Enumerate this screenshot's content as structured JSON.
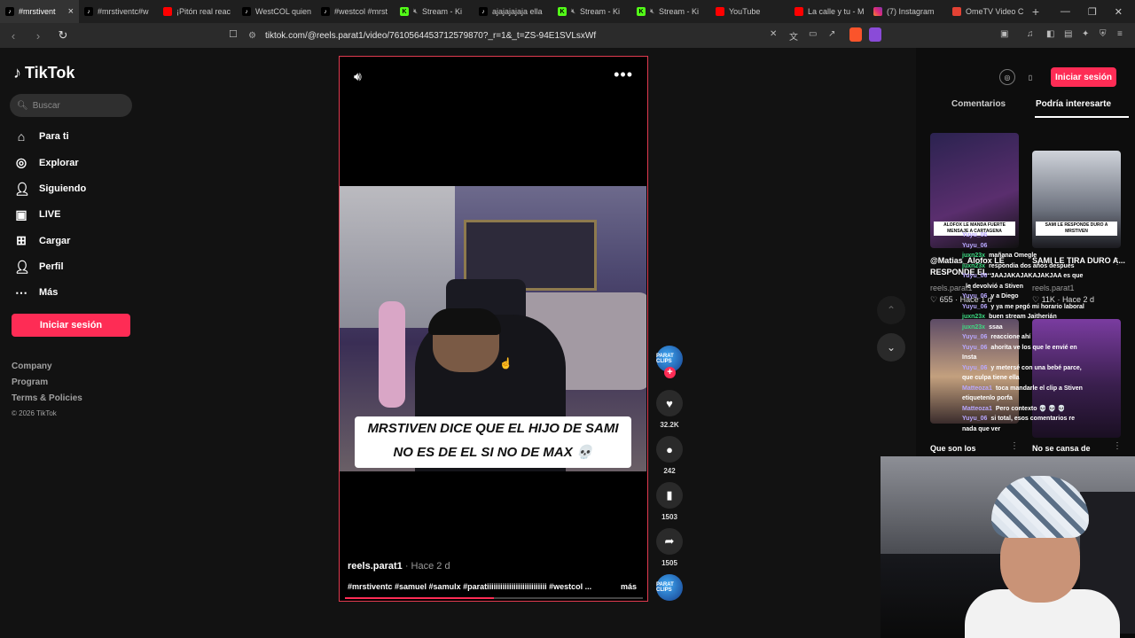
{
  "browser": {
    "tabs": [
      {
        "title": "#mrstivent",
        "fav": "tt",
        "active": true,
        "closable": true
      },
      {
        "title": "#mrstiventc#w",
        "fav": "tt"
      },
      {
        "title": "¡Pitón real reac",
        "fav": "yt"
      },
      {
        "title": "WestCOL quien",
        "fav": "tt"
      },
      {
        "title": "#westcol #mrst",
        "fav": "tt"
      },
      {
        "title": "Stream - Ki",
        "fav": "kick",
        "muted": true
      },
      {
        "title": "ajajajajaja ella",
        "fav": "tt"
      },
      {
        "title": "Stream - Ki",
        "fav": "kick",
        "muted": true
      },
      {
        "title": "Stream - Ki",
        "fav": "kick",
        "muted": true
      },
      {
        "title": "YouTube",
        "fav": "yt"
      },
      {
        "title": "La calle y tu - M",
        "fav": "yt"
      },
      {
        "title": "(7) Instagram",
        "fav": "ig"
      },
      {
        "title": "OmeTV Video C",
        "fav": "ome"
      }
    ],
    "url": "tiktok.com/@reels.parat1/video/7610564453712579870?_r=1&_t=ZS-94E1SVLsxWf"
  },
  "sidebar": {
    "logo": "TikTok",
    "search_placeholder": "Buscar",
    "nav": [
      {
        "label": "Para ti",
        "icon": "home-icon"
      },
      {
        "label": "Explorar",
        "icon": "compass-icon"
      },
      {
        "label": "Siguiendo",
        "icon": "following-icon"
      },
      {
        "label": "LIVE",
        "icon": "live-icon"
      },
      {
        "label": "Cargar",
        "icon": "upload-icon"
      },
      {
        "label": "Perfil",
        "icon": "profile-icon"
      },
      {
        "label": "Más",
        "icon": "more-icon"
      }
    ],
    "login": "Iniciar sesión",
    "footer": {
      "company": "Company",
      "program": "Program",
      "terms": "Terms & Policies",
      "copyright": "© 2026 TikTok"
    }
  },
  "video": {
    "caption_line1": "MRSTIVEN DICE QUE EL HIJO DE SAMI",
    "caption_line2": "NO ES DE EL SI NO DE MAX 💀",
    "author": "reels.parat1",
    "time": " · Hace 2 d",
    "tags": "#mrstiventc #samuel #samulx #paratiiiiiiiiiiiiiiiiiiiiiiiiiii #westcol ...",
    "more": "más",
    "progress": 0.5
  },
  "actions": {
    "likes": "32.2K",
    "comments": "242",
    "saves": "1503",
    "shares": "1505",
    "avatar_text": "PARAT CLIPS"
  },
  "right_panel": {
    "login": "Iniciar sesión",
    "tab_comments": "Comentarios",
    "tab_suggested": "Podría interesarte",
    "cards": [
      {
        "title": "@Matias_Alofox LE RESPONDE EL...",
        "author": "reels.parat1",
        "likes": "655",
        "time": "Hace 1 d",
        "thumb_caption": "ALOFOX LE MANDA FUERTE MENSAJE A CARTAGENA"
      },
      {
        "title": "SAMI LE TIRA DURO A...",
        "author": "reels.parat1",
        "likes": "11K",
        "time": "Hace 2 d",
        "thumb_caption": "SAMI LE RESPONDE DURO A MRSTIVEN"
      },
      {
        "title": "Que son los",
        "author": "",
        "likes": "",
        "time": ""
      },
      {
        "title": "No se cansa de",
        "author": "",
        "likes": "",
        "time": ""
      }
    ]
  },
  "chat": [
    {
      "user": "Yuyu_06",
      "color": "b",
      "msg": ""
    },
    {
      "user": "Yuyu_06",
      "color": "b",
      "msg": ""
    },
    {
      "user": "juxn23x",
      "color": "g",
      "msg": "mañana Omegle"
    },
    {
      "user": "juxn23x",
      "color": "g",
      "msg": "respondia dos años después"
    },
    {
      "user": "Yuyu_06",
      "color": "b",
      "msg": "JAAJAKAJAKAJAKJAA es que"
    },
    {
      "user": "",
      "color": "b",
      "msg": "le devolvió a Stiven"
    },
    {
      "user": "Yuyu_06",
      "color": "b",
      "msg": "y a Diego"
    },
    {
      "user": "Yuyu_06",
      "color": "b",
      "msg": "y ya me pegó mi horario laboral"
    },
    {
      "user": "juxn23x",
      "color": "g",
      "msg": "buen stream Jaitherián"
    },
    {
      "user": "juxn23x",
      "color": "g",
      "msg": "ssaa"
    },
    {
      "user": "Yuyu_06",
      "color": "b",
      "msg": "reaccione ahí"
    },
    {
      "user": "Yuyu_06",
      "color": "b",
      "msg": "ahorita ve los que le envié en Insta"
    },
    {
      "user": "Yuyu_06",
      "color": "b",
      "msg": "y metersé con una bebé parce, que culpa tiene ella"
    },
    {
      "user": "Matteoza1",
      "color": "b",
      "msg": "toca mandarle el clip a Stiven etiquetenlo porfa"
    },
    {
      "user": "Matteoza1",
      "color": "b",
      "msg": "Pero contexto 💀 💀 💀"
    },
    {
      "user": "Yuyu_06",
      "color": "b",
      "msg": "si total, esos comentarios re nada que ver"
    }
  ]
}
